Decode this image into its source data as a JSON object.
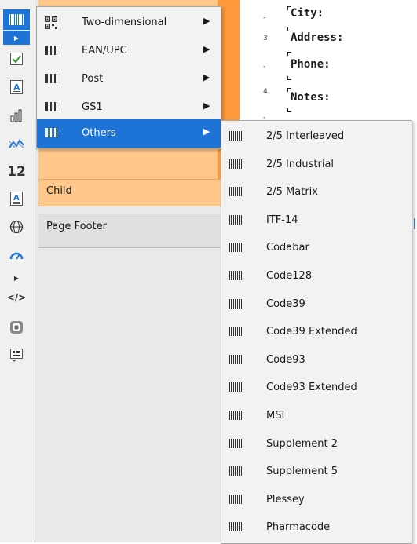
{
  "toolbar": {
    "icons": [
      "barcode-icon",
      "check-icon",
      "text-icon",
      "bar-chart-icon",
      "sparkline-icon",
      "number-icon",
      "rich-text-icon",
      "globe-icon",
      "gauge-icon",
      "html-icon",
      "shape-icon",
      "qr-code-icon"
    ],
    "number_glyph": "12"
  },
  "bands": {
    "child": "Child",
    "page_footer": "Page Footer"
  },
  "report": {
    "fields": [
      "City:",
      "Address:",
      "Phone:",
      "Notes:"
    ],
    "ruler": [
      "3",
      "4"
    ]
  },
  "main_menu": {
    "items": [
      {
        "label": "Two-dimensional",
        "icon": "qr-code-icon"
      },
      {
        "label": "EAN/UPC",
        "icon": "barcode-icon"
      },
      {
        "label": "Post",
        "icon": "barcode-icon"
      },
      {
        "label": "GS1",
        "icon": "barcode-icon"
      },
      {
        "label": "Others",
        "icon": "barcode-icon",
        "selected": true
      }
    ],
    "arrow": "▶"
  },
  "sub_menu": {
    "items": [
      "2/5 Interleaved",
      "2/5 Industrial",
      "2/5 Matrix",
      "ITF-14",
      "Codabar",
      "Code128",
      "Code39",
      "Code39 Extended",
      "Code93",
      "Code93 Extended",
      "MSI",
      "Supplement 2",
      "Supplement 5",
      "Plessey",
      "Pharmacode"
    ]
  },
  "colors": {
    "selection": "#1e73d6",
    "band": "#ffc88a",
    "band_accent": "#ff9a3c",
    "menu_bg": "#f2f2f2"
  }
}
